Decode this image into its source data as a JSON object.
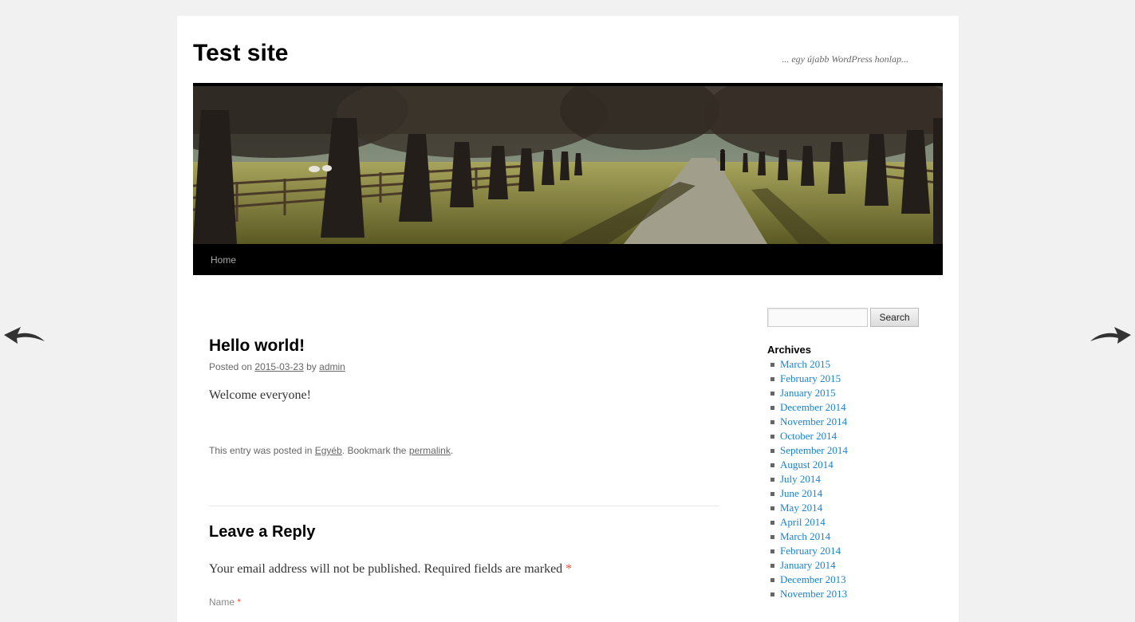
{
  "site": {
    "title": "Test site",
    "description": "... egy újabb WordPress honlap..."
  },
  "nav": {
    "home_label": "Home"
  },
  "post": {
    "title": "Hello world!",
    "posted_on_prefix": "Posted on",
    "date": "2015-03-23",
    "by": "by",
    "author": "admin",
    "content": "Welcome everyone!",
    "utility_prefix": "This entry was posted in",
    "category": "Egyéb",
    "utility_middle": ". Bookmark the",
    "permalink_label": "permalink",
    "utility_suffix": "."
  },
  "reply": {
    "title": "Leave a Reply",
    "notes": "Your email address will not be published. Required fields are marked",
    "required_mark": "*",
    "name_label": "Name",
    "name_required": "*"
  },
  "sidebar": {
    "search_value": "",
    "search_button": "Search",
    "archives_title": "Archives",
    "archives": [
      "March 2015",
      "February 2015",
      "January 2015",
      "December 2014",
      "November 2014",
      "October 2014",
      "September 2014",
      "August 2014",
      "July 2014",
      "June 2014",
      "May 2014",
      "April 2014",
      "March 2014",
      "February 2014",
      "January 2014",
      "December 2013",
      "November 2013"
    ]
  },
  "colors": {
    "background": "#f1f1f1",
    "link": "#1982d1",
    "nav_bar": "#000000",
    "required": "#ff4b33"
  },
  "icons": {
    "prev": "curved-arrow-left-icon",
    "next": "curved-arrow-right-icon"
  }
}
